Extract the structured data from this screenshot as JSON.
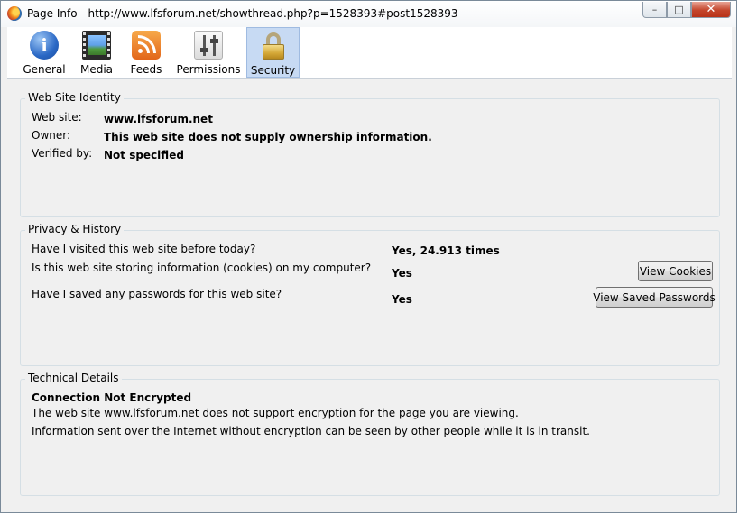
{
  "window": {
    "title": "Page Info - http://www.lfsforum.net/showthread.php?p=1528393#post1528393",
    "controls": {
      "minimize": "–",
      "maximize": "□",
      "close": "✕"
    }
  },
  "tabs": [
    {
      "label": "General",
      "icon": "info-icon",
      "selected": false
    },
    {
      "label": "Media",
      "icon": "media-icon",
      "selected": false
    },
    {
      "label": "Feeds",
      "icon": "feed-icon",
      "selected": false
    },
    {
      "label": "Permissions",
      "icon": "permissions-icon",
      "selected": false
    },
    {
      "label": "Security",
      "icon": "padlock-icon",
      "selected": true
    }
  ],
  "identity": {
    "legend": "Web Site Identity",
    "website_label": "Web site:",
    "website_value": "www.lfsforum.net",
    "owner_label": "Owner:",
    "owner_value": "This web site does not supply ownership information.",
    "verified_label": "Verified by:",
    "verified_value": "Not specified"
  },
  "privacy": {
    "legend": "Privacy & History",
    "visited_question": "Have I visited this web site before today?",
    "visited_answer": "Yes, 24.913 times",
    "cookies_question": "Is this web site storing information (cookies) on my computer?",
    "cookies_answer": "Yes",
    "cookies_button": "View Cookies",
    "passwords_question": "Have I saved any passwords for this web site?",
    "passwords_answer": "Yes",
    "passwords_button": "View Saved Passwords"
  },
  "technical": {
    "legend": "Technical Details",
    "heading": "Connection Not Encrypted",
    "line1": "The web site www.lfsforum.net does not support encryption for the page you are viewing.",
    "line2": "Information sent over the Internet without encryption can be seen by other people while it is in transit."
  }
}
